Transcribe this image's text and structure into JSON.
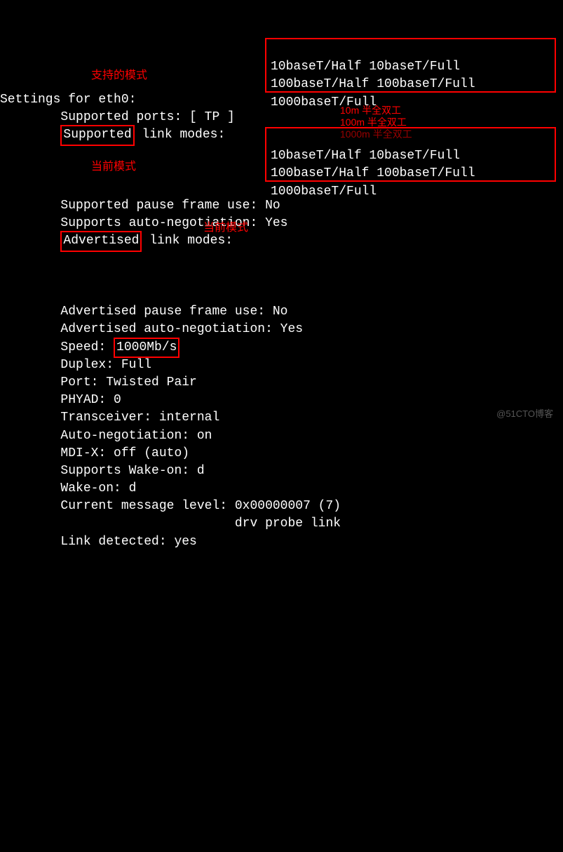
{
  "terminal": {
    "title": "Settings for eth0:",
    "indent": "        ",
    "lines": {
      "supported_ports": "Supported ports: [ TP ]",
      "supported_link_label": "Supported",
      "supported_link_rest": " link modes:   ",
      "link_modes_l1": "10baseT/Half 10baseT/Full",
      "link_modes_l2": "100baseT/Half 100baseT/Full",
      "link_modes_l3": "1000baseT/Full",
      "supported_pause": "Supported pause frame use: No",
      "supports_autoneg": "Supports auto-negotiation: Yes",
      "advertised_link_label": "Advertised",
      "advertised_link_rest": " link modes:  ",
      "advertised_pause": "Advertised pause frame use: No",
      "advertised_autoneg": "Advertised auto-negotiation: Yes",
      "speed_label": "Speed: ",
      "speed_value": "1000Mb/s",
      "duplex": "Duplex: Full",
      "port": "Port: Twisted Pair",
      "phyad": "PHYAD: 0",
      "transceiver": "Transceiver: internal",
      "autoneg": "Auto-negotiation: on",
      "mdix": "MDI-X: off (auto)",
      "supports_wakeon": "Supports Wake-on: d",
      "wakeon": "Wake-on: d",
      "curmsg_l1": "Current message level: 0x00000007 (7)",
      "curmsg_l2": "                       drv probe link",
      "link_detected": "Link detected: yes"
    }
  },
  "annotations": {
    "supported_mode": "支持的模式",
    "current_mode": "当前模式",
    "current_mode2": "当前模式",
    "duplex_10m": "10m 半全双工",
    "duplex_100m": "100m 半全双工",
    "duplex_1000m": "1000m 半全双工"
  },
  "watermark": "@51CTO博客"
}
